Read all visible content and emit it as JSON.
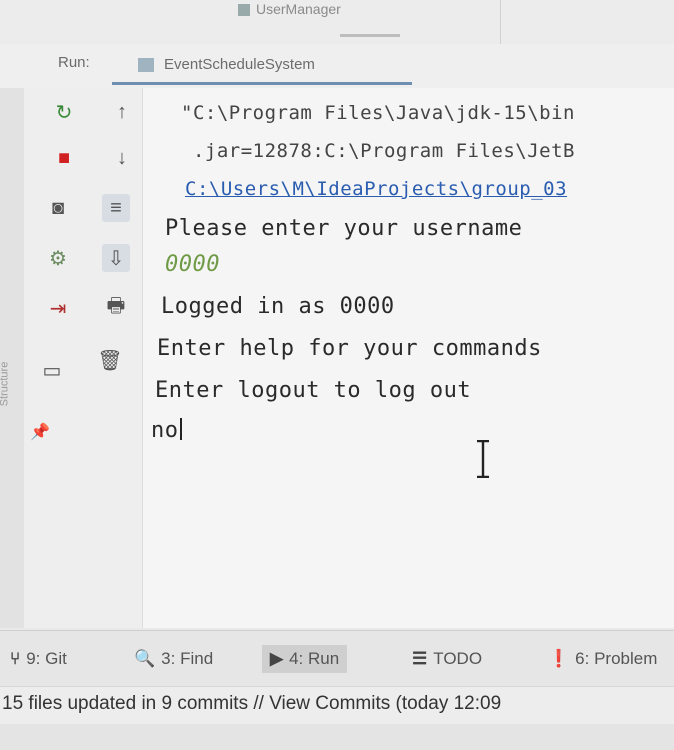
{
  "top": {
    "tab_label": "UserManager"
  },
  "run_header": {
    "label": "Run:",
    "tab": "EventScheduleSystem"
  },
  "side_text": "Structure",
  "toolbar": {
    "rerun": "↻",
    "up": "↑",
    "stop": "■",
    "down": "↓",
    "camera": "◙",
    "wrap": "≡",
    "debug": "⚙",
    "scroll": "⇩",
    "exit": "⇥",
    "print": "🖶",
    "layout": "▭",
    "trash": "🗑",
    "pin": "📌"
  },
  "console": {
    "lines": [
      "\"C:\\Program Files\\Java\\jdk-15\\bin",
      " .jar=12878:C:\\Program Files\\JetB",
      "C:\\Users\\M\\IdeaProjects\\group_03",
      "Please enter your username",
      "0000",
      "Logged in as 0000",
      "Enter help for your commands",
      "Enter logout to log out",
      "no"
    ]
  },
  "bottom_bar": {
    "items": [
      {
        "icon": "⑂",
        "label": "9: Git"
      },
      {
        "icon": "🔍",
        "label": "3: Find"
      },
      {
        "icon": "▶",
        "label": "4: Run"
      },
      {
        "icon": "☰",
        "label": "TODO"
      },
      {
        "icon": "❗",
        "label": "6: Problem"
      }
    ]
  },
  "status_bar": {
    "text": "15 files updated in 9 commits // View Commits (today 12:09"
  }
}
